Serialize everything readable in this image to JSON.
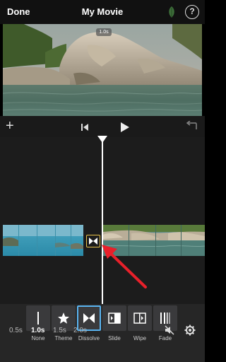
{
  "header": {
    "done_label": "Done",
    "title": "My Movie",
    "help_label": "?"
  },
  "preview": {
    "duration_badge": "1.0s"
  },
  "controls": {
    "add_label": "+"
  },
  "transitions": {
    "items": [
      {
        "label": "None",
        "icon": "none-transition-icon",
        "selected": false
      },
      {
        "label": "Theme",
        "icon": "star-icon",
        "selected": false
      },
      {
        "label": "Dissolve",
        "icon": "dissolve-icon",
        "selected": true
      },
      {
        "label": "Slide",
        "icon": "slide-icon",
        "selected": false
      },
      {
        "label": "Wipe",
        "icon": "wipe-icon",
        "selected": false
      },
      {
        "label": "Fade",
        "icon": "fade-icon",
        "selected": false
      }
    ]
  },
  "durations": {
    "options": [
      "0.5s",
      "1.0s",
      "1.5s",
      "2.0s"
    ],
    "selected": "1.0s"
  },
  "colors": {
    "accent": "#5ab4f0",
    "transition_marker": "#e8c24a",
    "annotation_arrow": "#e8202a"
  }
}
